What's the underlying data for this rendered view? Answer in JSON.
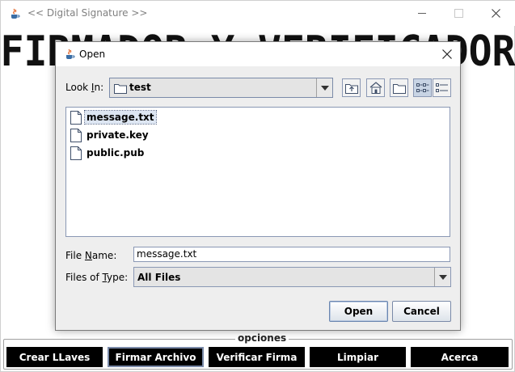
{
  "window": {
    "title": "<< Digital Signature >>",
    "banner_text": "FIRMADOR Y VERIFICADOR",
    "min_symbol": "—",
    "max_symbol": "☐",
    "close_symbol": "✕"
  },
  "options": {
    "label": "opciones",
    "buttons": [
      "Crear LLaves",
      "Firmar Archivo",
      "Verificar Firma",
      "Limpiar",
      "Acerca"
    ]
  },
  "dialog": {
    "title": "Open",
    "close_symbol": "✕",
    "look_in_label_pre": "Look ",
    "look_in_label_mnemonic": "I",
    "look_in_label_post": "n:",
    "look_in_value": "test",
    "files": [
      "message.txt",
      "private.key",
      "public.pub"
    ],
    "file_name_label_pre": "File ",
    "file_name_label_mnemonic": "N",
    "file_name_label_post": "ame:",
    "file_name_value": "message.txt",
    "files_of_type_label_pre": "Files of ",
    "files_of_type_label_mnemonic": "T",
    "files_of_type_label_post": "ype:",
    "files_of_type_value": "All Files",
    "open_label": "Open",
    "cancel_label": "Cancel"
  },
  "icons": {
    "app": "java-cup-icon",
    "folder": "folder-icon",
    "file": "document-icon",
    "up": "up-one-level-icon",
    "home": "home-icon",
    "new_folder": "new-folder-icon",
    "list": "list-view-icon",
    "details": "details-view-icon"
  },
  "colors": {
    "accent_border": "#7a8aa8",
    "selection": "#dde6f2",
    "option_button_bg": "#000000",
    "option_button_text": "#ffffff"
  }
}
